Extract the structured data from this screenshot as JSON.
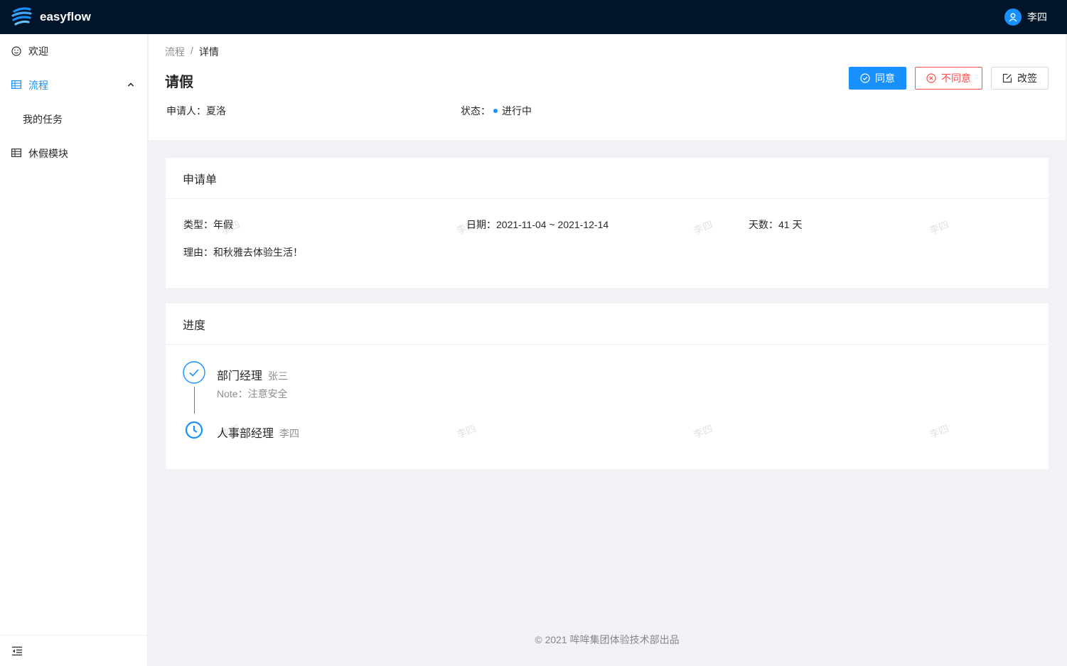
{
  "app": {
    "title": "easyflow",
    "user": "李四"
  },
  "sidebar": {
    "items": [
      {
        "label": "欢迎",
        "icon": "smile-icon"
      },
      {
        "label": "流程",
        "icon": "table-icon",
        "expanded": true,
        "children": [
          {
            "label": "我的任务"
          }
        ]
      },
      {
        "label": "休假模块",
        "icon": "table-icon"
      }
    ],
    "collapse_icon": "menu-fold-icon"
  },
  "header": {
    "breadcrumb": [
      "流程",
      "详情"
    ],
    "title": "请假",
    "applicant_label": "申请人：",
    "applicant": "夏洛",
    "status_label": "状态：",
    "status": "进行中",
    "buttons": {
      "approve": "同意",
      "reject": "不同意",
      "resign": "改签"
    }
  },
  "form_card": {
    "title": "申请单",
    "type_label": "类型：",
    "type": "年假",
    "date_label": "日期：",
    "date": "2021-11-04 ~ 2021-12-14",
    "days_label": "天数：",
    "days": "41 天",
    "reason_label": "理由：",
    "reason": "和秋雅去体验生活！"
  },
  "progress_card": {
    "title": "进度",
    "steps": [
      {
        "title": "部门经理",
        "person": "张三",
        "note": "Note：注意安全",
        "state": "done"
      },
      {
        "title": "人事部经理",
        "person": "李四",
        "state": "in-progress"
      }
    ]
  },
  "watermark": "李四",
  "footer": "2021 哞哞集团体验技术部出品",
  "colors": {
    "primary": "#1890ff",
    "danger": "#ff4d4f",
    "topbar": "#001529"
  }
}
